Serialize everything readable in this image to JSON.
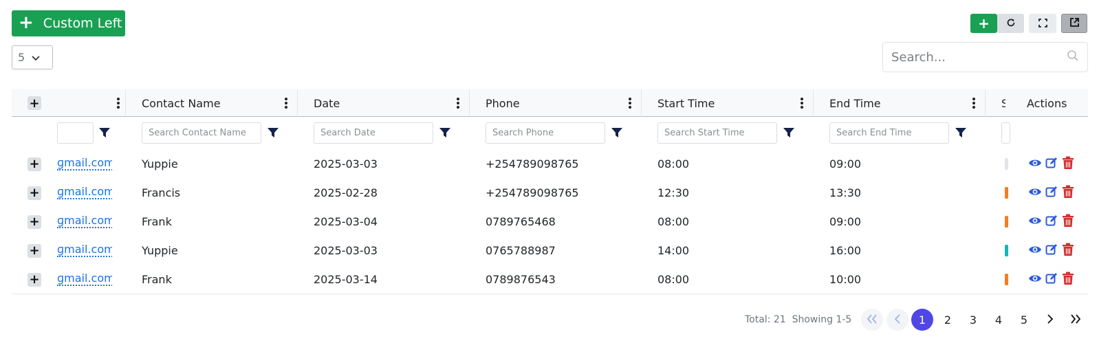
{
  "toolbar": {
    "custom_left_label": "Custom Left",
    "page_size": "5",
    "search_placeholder": "Search...",
    "icons": [
      "plus-icon",
      "refresh-icon",
      "fullscreen-icon",
      "external-link-icon",
      "search-icon"
    ]
  },
  "colors": {
    "success": "#1aa053",
    "link": "#1a73e8",
    "primary": "#4f46e5",
    "danger": "#d32f2f",
    "filter_icon": "#15224a"
  },
  "table": {
    "columns": [
      {
        "label": "",
        "filter_placeholder": ""
      },
      {
        "label": "Contact Name",
        "filter_placeholder": "Search Contact Name"
      },
      {
        "label": "Date",
        "filter_placeholder": "Search Date"
      },
      {
        "label": "Phone",
        "filter_placeholder": "Search Phone"
      },
      {
        "label": "Start Time",
        "filter_placeholder": "Search Start Time"
      },
      {
        "label": "End Time",
        "filter_placeholder": "Search End Time"
      },
      {
        "label": "S",
        "filter_placeholder": ""
      },
      {
        "label": "Actions",
        "filter_placeholder": ""
      }
    ],
    "rows": [
      {
        "email": "ɡmail.com",
        "contact": "Yuppie",
        "date": "2025-03-03",
        "phone": "+254789098765",
        "start": "08:00",
        "end": "09:00",
        "status_color": "#e2e4e7"
      },
      {
        "email": "ɡmail.com",
        "contact": "Francis",
        "date": "2025-02-28",
        "phone": "+254789098765",
        "start": "12:30",
        "end": "13:30",
        "status_color": "#f57c1f"
      },
      {
        "email": "ɡmail.com",
        "contact": "Frank",
        "date": "2025-03-04",
        "phone": "0789765468",
        "start": "08:00",
        "end": "09:00",
        "status_color": "#f57c1f"
      },
      {
        "email": "ɡmail.com",
        "contact": "Yuppie",
        "date": "2025-03-03",
        "phone": "0765788987",
        "start": "14:00",
        "end": "16:00",
        "status_color": "#14b8b8"
      },
      {
        "email": "ɡmail.com",
        "contact": "Frank",
        "date": "2025-03-14",
        "phone": "0789876543",
        "start": "08:00",
        "end": "10:00",
        "status_color": "#f57c1f"
      }
    ],
    "action_icons": [
      "eye-icon",
      "edit-icon",
      "trash-icon"
    ]
  },
  "pagination": {
    "total": "Total: 21",
    "showing": "Showing 1-5",
    "pages": [
      "1",
      "2",
      "3",
      "4",
      "5"
    ],
    "current": "1"
  }
}
